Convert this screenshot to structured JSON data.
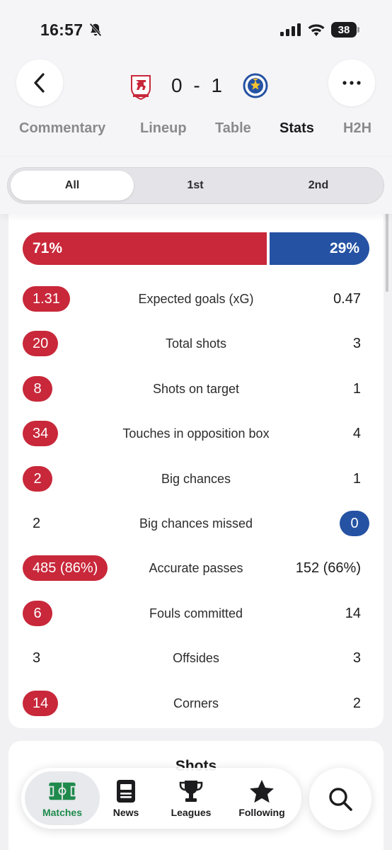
{
  "status_bar": {
    "time": "16:57",
    "battery": "38"
  },
  "header": {
    "score": "0 - 1",
    "home_crest_icon": "middlesbrough-lion-crest-icon",
    "away_crest_icon": "portsmouth-star-crest-icon"
  },
  "tabs": [
    "Commentary",
    "Lineup",
    "Table",
    "Stats",
    "H2H"
  ],
  "active_tab": "Stats",
  "periods": [
    "All",
    "1st",
    "2nd"
  ],
  "active_period": "All",
  "possession": {
    "home": "71%",
    "away": "29%",
    "home_fraction": 0.71
  },
  "stats": [
    {
      "label": "Expected goals (xG)",
      "home": "1.31",
      "away": "0.47",
      "highlight": "home"
    },
    {
      "label": "Total shots",
      "home": "20",
      "away": "3",
      "highlight": "home"
    },
    {
      "label": "Shots on target",
      "home": "8",
      "away": "1",
      "highlight": "home"
    },
    {
      "label": "Touches in opposition box",
      "home": "34",
      "away": "4",
      "highlight": "home"
    },
    {
      "label": "Big chances",
      "home": "2",
      "away": "1",
      "highlight": "home"
    },
    {
      "label": "Big chances missed",
      "home": "2",
      "away": "0",
      "highlight": "away"
    },
    {
      "label": "Accurate passes",
      "home": "485 (86%)",
      "away": "152 (66%)",
      "highlight": "home"
    },
    {
      "label": "Fouls committed",
      "home": "6",
      "away": "14",
      "highlight": "home"
    },
    {
      "label": "Offsides",
      "home": "3",
      "away": "3",
      "highlight": "none"
    },
    {
      "label": "Corners",
      "home": "14",
      "away": "2",
      "highlight": "home"
    }
  ],
  "next_section_title": "Shots",
  "colors": {
    "home": "#c8283a",
    "away": "#2552a3",
    "active_nav": "#1f8a4c"
  },
  "nav": [
    {
      "label": "Matches",
      "icon": "pitch-icon"
    },
    {
      "label": "News",
      "icon": "newspaper-icon"
    },
    {
      "label": "Leagues",
      "icon": "trophy-icon"
    },
    {
      "label": "Following",
      "icon": "star-icon"
    }
  ],
  "active_nav": "Matches",
  "search_icon": "search-icon"
}
